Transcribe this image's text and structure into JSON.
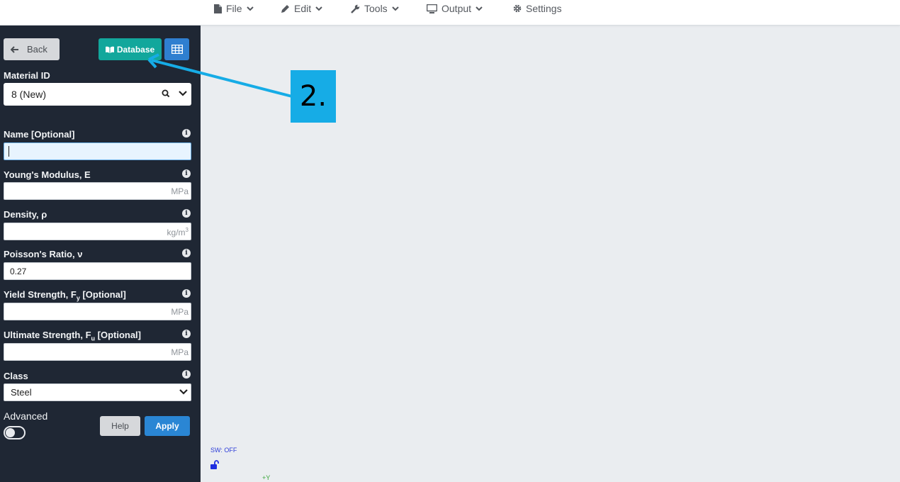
{
  "menu": {
    "file": "File",
    "edit": "Edit",
    "tools": "Tools",
    "output": "Output",
    "settings": "Settings"
  },
  "sidebar": {
    "back_label": "Back",
    "database_label": "Database",
    "material_id": {
      "label": "Material ID",
      "value": "8 (New)"
    },
    "fields": {
      "name": {
        "label": "Name [Optional]",
        "value": ""
      },
      "youngs": {
        "label": "Young's Modulus, E",
        "value": "",
        "unit": "MPa"
      },
      "density": {
        "label": "Density, ρ",
        "value": "",
        "unit": "kg/m",
        "unit_sup": "3"
      },
      "poisson": {
        "label": "Poisson's Ratio, ν",
        "value": "0.27"
      },
      "yield": {
        "label_pre": "Yield Strength, F",
        "label_sub": "y",
        "label_post": " [Optional]",
        "value": "",
        "unit": "MPa"
      },
      "ultimate": {
        "label_pre": "Ultimate Strength, F",
        "label_sub": "u",
        "label_post": " [Optional]",
        "value": "",
        "unit": "MPa"
      }
    },
    "class": {
      "label": "Class",
      "value": "Steel"
    },
    "advanced": {
      "label": "Advanced",
      "enabled": false
    },
    "help_label": "Help",
    "apply_label": "Apply"
  },
  "canvas": {
    "sw_status": "SW: OFF",
    "axis_label": "+Y"
  },
  "annotation": {
    "step_label": "2."
  },
  "colors": {
    "sidebar_bg": "#1f2734",
    "database_button": "#12a79c",
    "apply_button": "#2a86d4",
    "annotation": "#16ace6"
  }
}
